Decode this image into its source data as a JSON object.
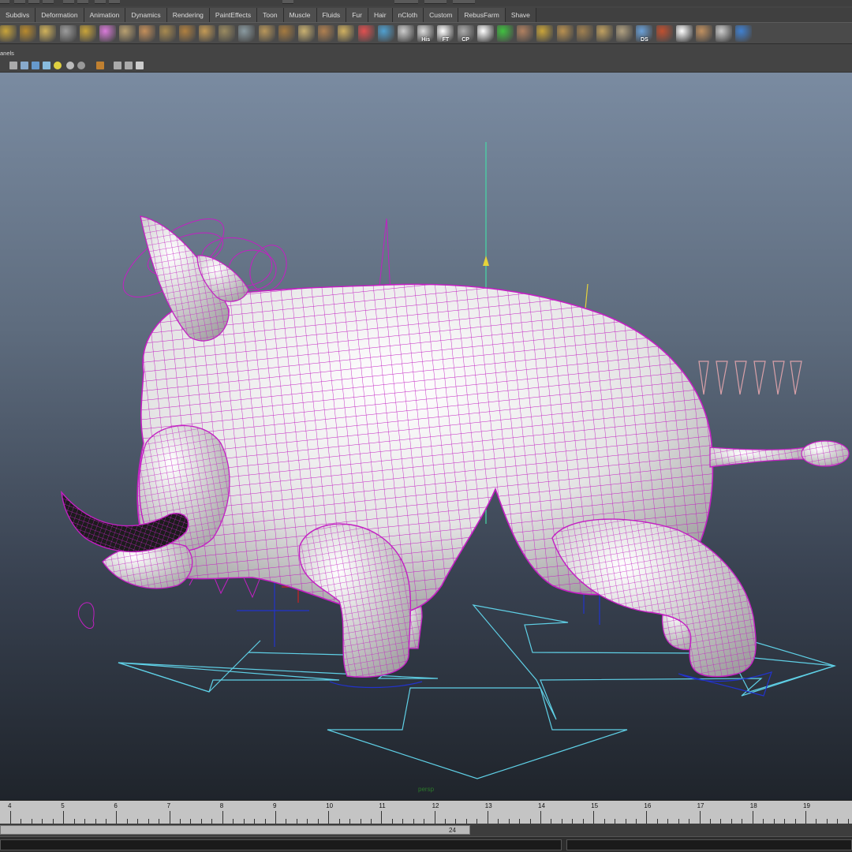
{
  "shelf_tabs": [
    "Subdivs",
    "Deformation",
    "Animation",
    "Dynamics",
    "Rendering",
    "PaintEffects",
    "Toon",
    "Muscle",
    "Fluids",
    "Fur",
    "Hair",
    "nCloth",
    "Custom",
    "RebusFarm",
    "Shave"
  ],
  "shelf_icon_labels": {
    "his": "His",
    "ft": "FT",
    "cp": "CP",
    "ds": "DS"
  },
  "panel_menu_label": "anels",
  "viewport": {
    "camera_label": "persp",
    "wireframe_color": "#cc33cc",
    "control_color": "#5fd0e6"
  },
  "timeline": {
    "ticks": [
      "4",
      "5",
      "6",
      "7",
      "8",
      "9",
      "10",
      "11",
      "12",
      "13",
      "14",
      "15",
      "16",
      "17",
      "18",
      "19"
    ],
    "range_end": "24"
  },
  "colors": {
    "viewport_top": "#7a8ba1",
    "viewport_bottom": "#1f242b",
    "ui_dark": "#444444"
  }
}
